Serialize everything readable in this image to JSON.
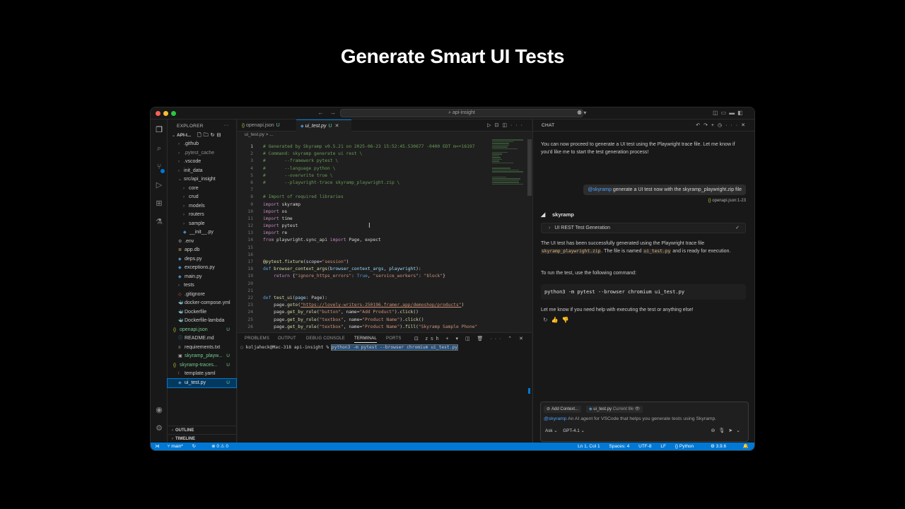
{
  "headline": "Generate Smart UI Tests",
  "window": {
    "search_text": "⌕ api-insight"
  },
  "explorer": {
    "title": "EXPLORER",
    "project": "API-I...",
    "items": [
      {
        "label": ".github",
        "type": "folder",
        "indent": 1,
        "color": "default"
      },
      {
        "label": ".pytest_cache",
        "type": "folder",
        "indent": 1,
        "color": "gray"
      },
      {
        "label": ".vscode",
        "type": "folder",
        "indent": 1,
        "color": "default"
      },
      {
        "label": "init_data",
        "type": "folder",
        "indent": 1,
        "color": "default"
      },
      {
        "label": "src/api_insight",
        "type": "folder-open",
        "indent": 1,
        "color": "default"
      },
      {
        "label": "core",
        "type": "folder",
        "indent": 2,
        "color": "default"
      },
      {
        "label": "crud",
        "type": "folder",
        "indent": 2,
        "color": "default"
      },
      {
        "label": "models",
        "type": "folder",
        "indent": 2,
        "color": "default"
      },
      {
        "label": "routers",
        "type": "folder",
        "indent": 2,
        "color": "default"
      },
      {
        "label": "sample",
        "type": "folder",
        "indent": 2,
        "color": "default"
      },
      {
        "label": "__init__.py",
        "type": "py",
        "indent": 2,
        "color": "default"
      },
      {
        "label": ".env",
        "type": "gear",
        "indent": 1,
        "color": "default"
      },
      {
        "label": "app.db",
        "type": "db",
        "indent": 1,
        "color": "default"
      },
      {
        "label": "deps.py",
        "type": "py",
        "indent": 1,
        "color": "default"
      },
      {
        "label": "exceptions.py",
        "type": "py",
        "indent": 1,
        "color": "default"
      },
      {
        "label": "main.py",
        "type": "py",
        "indent": 1,
        "color": "default"
      },
      {
        "label": "tests",
        "type": "folder",
        "indent": 1,
        "color": "default"
      },
      {
        "label": ".gitignore",
        "type": "git",
        "indent": 1,
        "color": "default"
      },
      {
        "label": "docker-compose.yml",
        "type": "docker",
        "indent": 1,
        "color": "default"
      },
      {
        "label": "Dockerfile",
        "type": "docker",
        "indent": 1,
        "color": "default"
      },
      {
        "label": "Dockerfile-lambda",
        "type": "docker",
        "indent": 1,
        "color": "default"
      },
      {
        "label": "openapi.json",
        "type": "json",
        "indent": 0,
        "color": "green",
        "status": "U"
      },
      {
        "label": "README.md",
        "type": "info",
        "indent": 1,
        "color": "default"
      },
      {
        "label": "requirements.txt",
        "type": "txt",
        "indent": 1,
        "color": "default"
      },
      {
        "label": "skyramp_playw...",
        "type": "zip",
        "indent": 1,
        "color": "green",
        "status": "U"
      },
      {
        "label": "skyramp-traces...",
        "type": "json",
        "indent": 0,
        "color": "green",
        "status": "U"
      },
      {
        "label": "template.yaml",
        "type": "yaml",
        "indent": 1,
        "color": "default"
      },
      {
        "label": "ui_test.py",
        "type": "py",
        "indent": 1,
        "color": "green",
        "status": "U",
        "selected": true
      }
    ],
    "outline_label": "OUTLINE",
    "timeline_label": "TIMELINE"
  },
  "editor": {
    "tabs": [
      {
        "label": "openapi.json",
        "status": "U",
        "active": false
      },
      {
        "label": "ui_test.py",
        "status": "U",
        "active": true
      }
    ],
    "breadcrumb": "ui_test.py > ...",
    "lines": [
      [
        [
          "comment",
          "# Generated by Skyramp v0.5.21 on 2025-06-23 15:52:45.530677 -0400 EDT m=+16197"
        ]
      ],
      [
        [
          "comment",
          "# Command: skyramp generate ui rest \\"
        ]
      ],
      [
        [
          "comment",
          "#       --framework pytest \\"
        ]
      ],
      [
        [
          "comment",
          "#       --language python \\"
        ]
      ],
      [
        [
          "comment",
          "#       --overwrite true \\"
        ]
      ],
      [
        [
          "comment",
          "#       --playwright-trace skyramp_playwright.zip \\"
        ]
      ],
      [],
      [
        [
          "comment",
          "# Import of required libraries"
        ]
      ],
      [
        [
          "kw2",
          "import"
        ],
        [
          "txt",
          " skyramp"
        ]
      ],
      [
        [
          "kw2",
          "import"
        ],
        [
          "txt",
          " os"
        ]
      ],
      [
        [
          "kw2",
          "import"
        ],
        [
          "txt",
          " time"
        ]
      ],
      [
        [
          "kw2",
          "import"
        ],
        [
          "txt",
          " pytest"
        ]
      ],
      [
        [
          "kw2",
          "import"
        ],
        [
          "txt",
          " re"
        ]
      ],
      [
        [
          "kw2",
          "from"
        ],
        [
          "txt",
          " playwright.sync_api "
        ],
        [
          "kw2",
          "import"
        ],
        [
          "txt",
          " Page, expect"
        ]
      ],
      [],
      [],
      [
        [
          "dec",
          "@pytest.fixture"
        ],
        [
          "txt",
          "(scope="
        ],
        [
          "str",
          "\"session\""
        ],
        [
          "txt",
          ")"
        ]
      ],
      [
        [
          "kw",
          "def"
        ],
        [
          "txt",
          " "
        ],
        [
          "fn",
          "browser_context_args"
        ],
        [
          "txt",
          "("
        ],
        [
          "param",
          "browser_context_args"
        ],
        [
          "txt",
          ", "
        ],
        [
          "param",
          "playwright"
        ],
        [
          "txt",
          "):"
        ]
      ],
      [
        [
          "txt",
          "    "
        ],
        [
          "kw2",
          "return"
        ],
        [
          "txt",
          " {"
        ],
        [
          "str",
          "\"ignore_https_errors\""
        ],
        [
          "txt",
          ": "
        ],
        [
          "kw",
          "True"
        ],
        [
          "txt",
          ", "
        ],
        [
          "str",
          "\"service_workers\""
        ],
        [
          "txt",
          ": "
        ],
        [
          "str",
          "\"block\""
        ],
        [
          "txt",
          "}"
        ]
      ],
      [],
      [],
      [
        [
          "kw",
          "def"
        ],
        [
          "txt",
          " "
        ],
        [
          "fn",
          "test_ui"
        ],
        [
          "txt",
          "("
        ],
        [
          "param",
          "page"
        ],
        [
          "txt",
          ": Page):"
        ]
      ],
      [
        [
          "txt",
          "    page."
        ],
        [
          "fn",
          "goto"
        ],
        [
          "txt",
          "("
        ],
        [
          "url",
          "\"https://lovely-writers-250196.framer.app/demoshop/products\""
        ],
        [
          "txt",
          ")"
        ]
      ],
      [
        [
          "txt",
          "    page."
        ],
        [
          "fn",
          "get_by_role"
        ],
        [
          "txt",
          "("
        ],
        [
          "str",
          "\"button\""
        ],
        [
          "txt",
          ", name="
        ],
        [
          "str",
          "\"Add Product\""
        ],
        [
          "txt",
          ")."
        ],
        [
          "fn",
          "click"
        ],
        [
          "txt",
          "()"
        ]
      ],
      [
        [
          "txt",
          "    page."
        ],
        [
          "fn",
          "get_by_role"
        ],
        [
          "txt",
          "("
        ],
        [
          "str",
          "\"textbox\""
        ],
        [
          "txt",
          ", name="
        ],
        [
          "str",
          "\"Product Name\""
        ],
        [
          "txt",
          ")."
        ],
        [
          "fn",
          "click"
        ],
        [
          "txt",
          "()"
        ]
      ],
      [
        [
          "txt",
          "    page."
        ],
        [
          "fn",
          "get_by_role"
        ],
        [
          "txt",
          "("
        ],
        [
          "str",
          "\"textbox\""
        ],
        [
          "txt",
          ", name="
        ],
        [
          "str",
          "\"Product Name\""
        ],
        [
          "txt",
          ")."
        ],
        [
          "fn",
          "fill"
        ],
        [
          "txt",
          "("
        ],
        [
          "str",
          "\"Skyramp Sample Phone\""
        ]
      ]
    ]
  },
  "panel": {
    "tabs": [
      "PROBLEMS",
      "OUTPUT",
      "DEBUG CONSOLE",
      "TERMINAL",
      "PORTS"
    ],
    "active_tab": "TERMINAL",
    "shell": "zsh",
    "prompt": "koljaheck@Mac-318 api-insight % ",
    "command": "python3 -m pytest --browser chromium ui_test.py"
  },
  "chat": {
    "title": "CHAT",
    "intro": "You can now proceed to generate a UI test using the Playwright trace file. Let me know if you'd like me to start the test generation process!",
    "user_mention": "@skyramp",
    "user_message": " generate a UI test now with the skyramp_playwright.zip file",
    "reference": "openapi.json:1-23",
    "bot_name": "skyramp",
    "tool_label": "UI REST Test Generation",
    "result_part1": "The UI test has been successfully generated using the Playwright trace file ",
    "result_code1": "skyramp_playwright.zip",
    "result_part2": ". The file is named ",
    "result_code2": "ui_test.py",
    "result_part3": " and is ready for execution.",
    "run_intro": "To run the test, use the following command:",
    "command": "python3 -m pytest --browser chromium ui_test.py",
    "closing": "Let me know if you need help with executing the test or anything else!",
    "add_context": "Add Context...",
    "current_file": "ui_test.py",
    "current_file_note": "Current file",
    "input_mention": "@skyramp",
    "input_placeholder": " An AI agent for VSCode that helps you generate tests using Skyramp.",
    "mode": "Ask",
    "model": "GPT-4.1"
  },
  "statusbar": {
    "branch": "main*",
    "sync": "↻",
    "problems": "⊗ 0 ⚠ 0",
    "position": "Ln 1, Col 1",
    "spaces": "Spaces: 4",
    "encoding": "UTF-8",
    "eol": "LF",
    "language": "Python",
    "python_version": "3.9.6"
  },
  "colors": {
    "accent": "#0078d4",
    "untracked": "#73c991",
    "background": "#1f1f1f"
  }
}
